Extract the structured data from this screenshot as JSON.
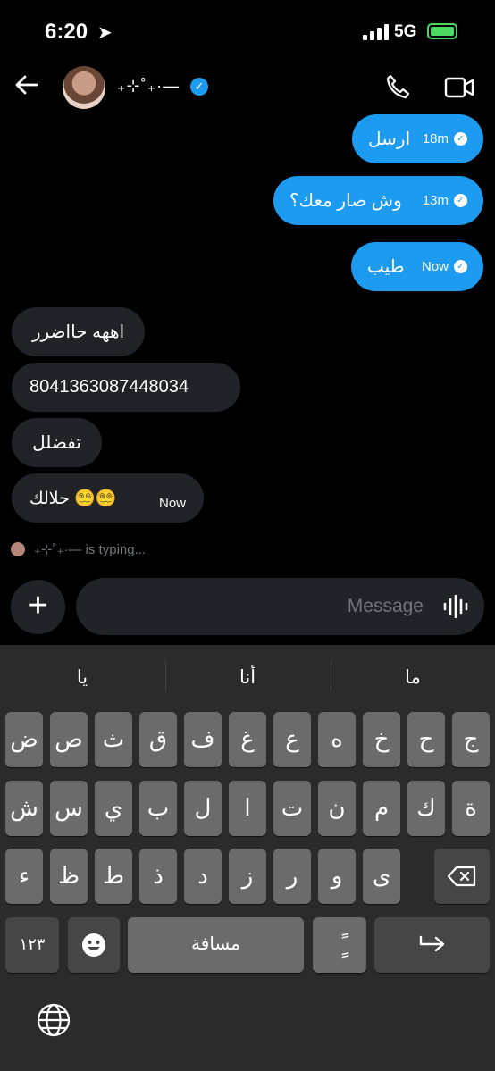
{
  "status_bar": {
    "time": "6:20",
    "network": "5G"
  },
  "header": {
    "contact_name": "₊⊹˚₊·—"
  },
  "messages": [
    {
      "text": "ارسل",
      "time": "18m"
    },
    {
      "text": "وش صار معك؟",
      "time": "13m"
    },
    {
      "text": "طيب",
      "time": "Now"
    },
    {
      "text": "اههه حااضرر"
    },
    {
      "text": "8041363087448034"
    },
    {
      "text": "تفضلل"
    },
    {
      "text": "حلالك 😵‍💫😵‍💫",
      "time": "Now"
    }
  ],
  "typing": {
    "text": "₊⊹˚₊·— is typing..."
  },
  "composer": {
    "placeholder": "Message"
  },
  "keyboard": {
    "suggestions": [
      "يا",
      "أنا",
      "ما"
    ],
    "row1": [
      "ض",
      "ص",
      "ث",
      "ق",
      "ف",
      "غ",
      "ع",
      "ه",
      "خ",
      "ح",
      "ج"
    ],
    "row2": [
      "ش",
      "س",
      "ي",
      "ب",
      "ل",
      "ا",
      "ت",
      "ن",
      "م",
      "ك",
      "ة"
    ],
    "row3": [
      "ء",
      "ظ",
      "ط",
      "ذ",
      "د",
      "ز",
      "ر",
      "و",
      "ى"
    ],
    "numbers_label": "١٢٣",
    "space_label": "مسافة",
    "diacritic_label": "ًٍ"
  }
}
